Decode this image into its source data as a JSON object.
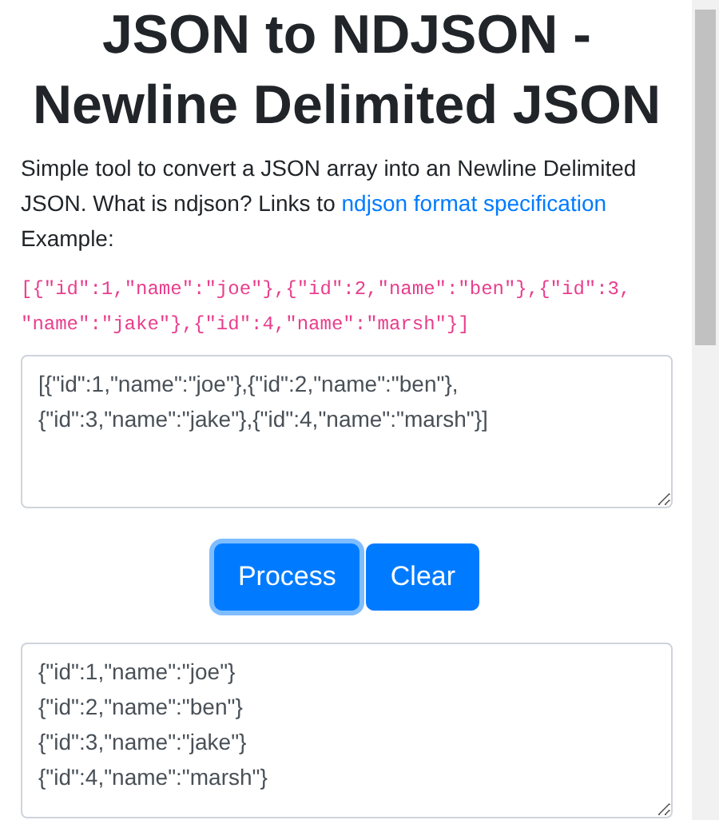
{
  "title": "JSON to NDJSON - Newline Delimited JSON",
  "intro": {
    "text": "Simple tool to convert a JSON array into an Newline Delimited JSON. What is ndjson? Links to",
    "link": "ndjson format specification",
    "example_label": "Example:"
  },
  "example_code": "[{\"id\":1,\"name\":\"joe\"},{\"id\":2,\"name\":\"ben\"},{\"id\":3,\"name\":\"jake\"},{\"id\":4,\"name\":\"marsh\"}]",
  "input": {
    "value": "[{\"id\":1,\"name\":\"joe\"},{\"id\":2,\"name\":\"ben\"},{\"id\":3,\"name\":\"jake\"},{\"id\":4,\"name\":\"marsh\"}]"
  },
  "buttons": [
    {
      "label": "Process",
      "focused": true
    },
    {
      "label": "Clear",
      "focused": false
    }
  ],
  "output": {
    "lines": [
      "{\"id\":1,\"name\":\"joe\"}",
      "{\"id\":2,\"name\":\"ben\"}",
      "{\"id\":3,\"name\":\"jake\"}",
      "{\"id\":4,\"name\":\"marsh\"}"
    ]
  }
}
